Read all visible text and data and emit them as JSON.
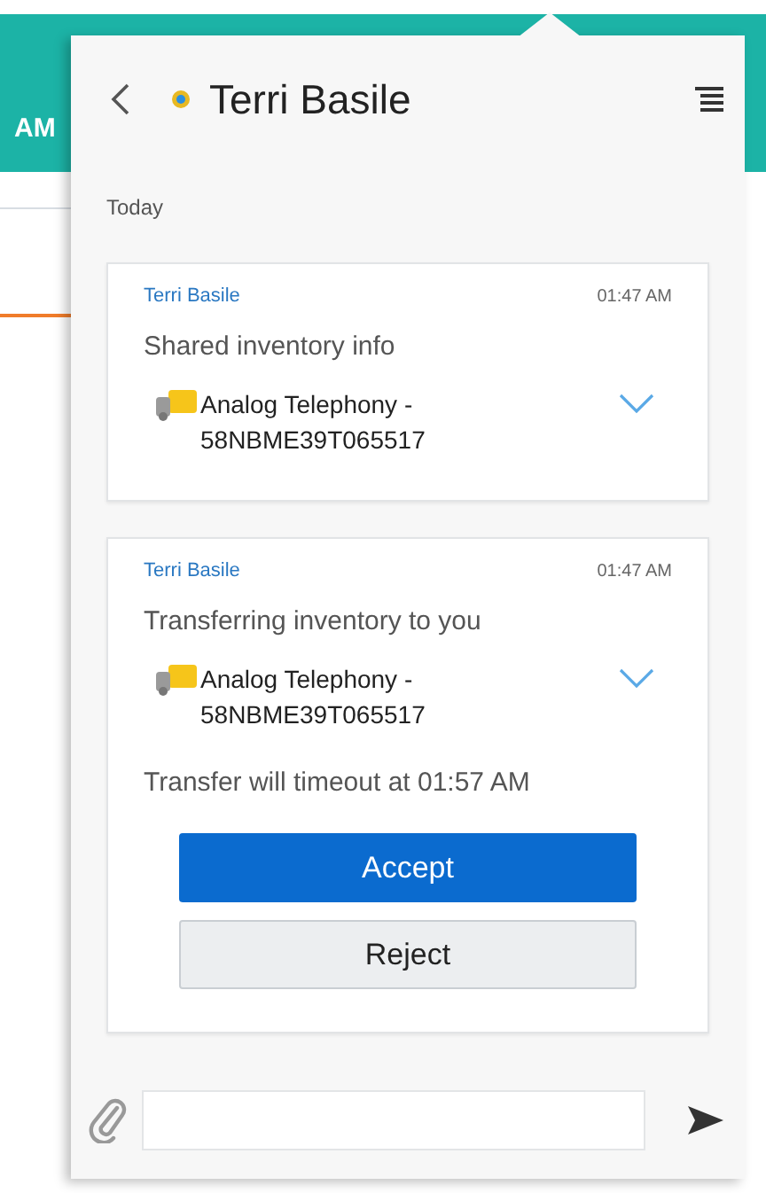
{
  "background_app": {
    "header_text": "AM"
  },
  "conversation": {
    "title": "Terri Basile",
    "date_label": "Today"
  },
  "messages": [
    {
      "sender": "Terri Basile",
      "time": "01:47 AM",
      "text": "Shared inventory info",
      "item": "Analog Telephony - 58NBME39T065517"
    },
    {
      "sender": "Terri Basile",
      "time": "01:47 AM",
      "text": "Transferring inventory to you",
      "item": "Analog Telephony - 58NBME39T065517",
      "note": "Transfer will timeout at 01:57 AM",
      "actions": [
        {
          "label": "Accept",
          "kind": "primary"
        },
        {
          "label": "Reject",
          "kind": "secondary"
        }
      ]
    }
  ]
}
